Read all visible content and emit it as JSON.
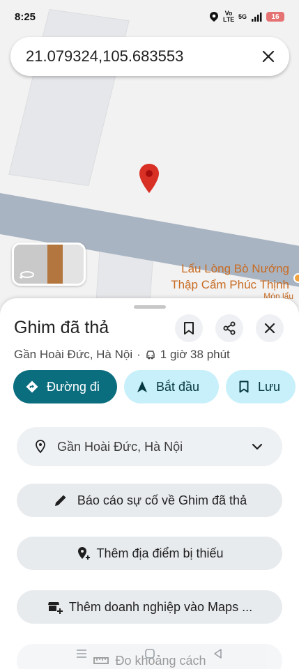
{
  "status_bar": {
    "time": "8:25",
    "network_label": "Vo LTE",
    "signal_label": "5G",
    "battery_level": "16"
  },
  "search": {
    "query": "21.079324,105.683553"
  },
  "map": {
    "poi_name_line1": "Lẩu Lòng Bò Nướng",
    "poi_name_line2": "Thập Cẩm Phúc Thịnh",
    "poi_category": "Món lẩu",
    "pin_color": "#d93025",
    "poi_color": "#c86b22"
  },
  "place": {
    "title": "Ghim đã thả",
    "location": "Gần Hoài Đức, Hà Nội",
    "separator": "·",
    "drive_time": "1 giờ 38 phút"
  },
  "actions": {
    "directions_label": "Đường đi",
    "start_label": "Bắt đầu",
    "save_label": "Lưu",
    "primary_color": "#0b6e7f",
    "secondary_color": "#c8f0fa"
  },
  "rows": {
    "location_label": "Gần Hoài Đức, Hà Nội",
    "report_label": "Báo cáo sự cố về Ghim đã thả",
    "add_place_label": "Thêm địa điểm bị thiếu",
    "add_business_label": "Thêm doanh nghiệp vào Maps ...",
    "measure_label": "Đo khoảng cách"
  }
}
